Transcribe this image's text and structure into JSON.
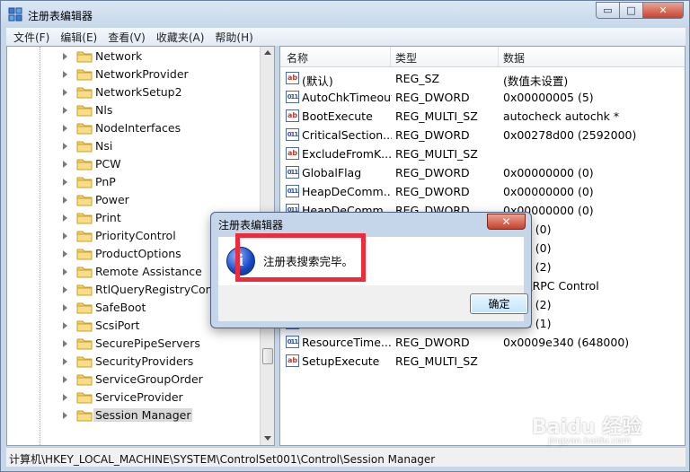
{
  "window": {
    "title": "注册表编辑器",
    "icon": "registry-icon"
  },
  "controls": {
    "minimize": "▭",
    "maximize": "□",
    "close": "✕"
  },
  "menu": [
    {
      "label": "文件(F)"
    },
    {
      "label": "编辑(E)"
    },
    {
      "label": "查看(V)"
    },
    {
      "label": "收藏夹(A)"
    },
    {
      "label": "帮助(H)"
    }
  ],
  "tree": {
    "items": [
      "Network",
      "NetworkProvider",
      "NetworkSetup2",
      "Nls",
      "NodeInterfaces",
      "Nsi",
      "PCW",
      "PnP",
      "Power",
      "Print",
      "PriorityControl",
      "ProductOptions",
      "Remote Assistance",
      "RtlQueryRegistryConfig",
      "SafeBoot",
      "ScsiPort",
      "SecurePipeServers",
      "SecurityProviders",
      "ServiceGroupOrder",
      "ServiceProvider",
      "Session Manager"
    ],
    "selected": "Session Manager"
  },
  "list": {
    "headers": {
      "name": "名称",
      "type": "类型",
      "data": "数据"
    },
    "rows": [
      {
        "icon": "ab",
        "name": "(默认)",
        "type": "REG_SZ",
        "data": "(数值未设置)"
      },
      {
        "icon": "bin",
        "name": "AutoChkTimeout",
        "type": "REG_DWORD",
        "data": "0x00000005 (5)"
      },
      {
        "icon": "ab",
        "name": "BootExecute",
        "type": "REG_MULTI_SZ",
        "data": "autocheck autochk *"
      },
      {
        "icon": "bin",
        "name": "CriticalSection...",
        "type": "REG_DWORD",
        "data": "0x00278d00 (2592000)"
      },
      {
        "icon": "ab",
        "name": "ExcludeFromK...",
        "type": "REG_MULTI_SZ",
        "data": ""
      },
      {
        "icon": "bin",
        "name": "GlobalFlag",
        "type": "REG_DWORD",
        "data": "0x00000000 (0)"
      },
      {
        "icon": "bin",
        "name": "HeapDeComm...",
        "type": "REG_DWORD",
        "data": "0x00000000 (0)"
      },
      {
        "icon": "bin",
        "name": "HeapDeComm...",
        "type": "REG_DWORD",
        "data": "0x00000000 (0)"
      },
      {
        "icon": "bin",
        "name": "",
        "type": "",
        "data": "0000 (0)"
      },
      {
        "icon": "bin",
        "name": "",
        "type": "",
        "data": "0000 (0)"
      },
      {
        "icon": "bin",
        "name": "",
        "type": "",
        "data": "0002 (2)"
      },
      {
        "icon": "ab",
        "name": "",
        "type": "",
        "data": "ows \\RPC Control"
      },
      {
        "icon": "bin",
        "name": "",
        "type": "",
        "data": "0002 (2)"
      },
      {
        "icon": "bin",
        "name": "",
        "type": "",
        "data": "0001 (1)"
      },
      {
        "icon": "bin",
        "name": "ResourceTime...",
        "type": "REG_DWORD",
        "data": "0x0009e340 (648000)"
      },
      {
        "icon": "ab",
        "name": "SetupExecute",
        "type": "REG_MULTI_SZ",
        "data": ""
      }
    ]
  },
  "status": "计算机\\HKEY_LOCAL_MACHINE\\SYSTEM\\ControlSet001\\Control\\Session Manager",
  "dialog": {
    "title": "注册表编辑器",
    "close": "✕",
    "icon": "info-icon",
    "message": "注册表搜索完毕。",
    "ok": "确定"
  },
  "annotation": {
    "color": "#ee2b3b"
  },
  "watermark": {
    "logo": "Baidu 经验",
    "url": "jingyan.baidu.com"
  }
}
